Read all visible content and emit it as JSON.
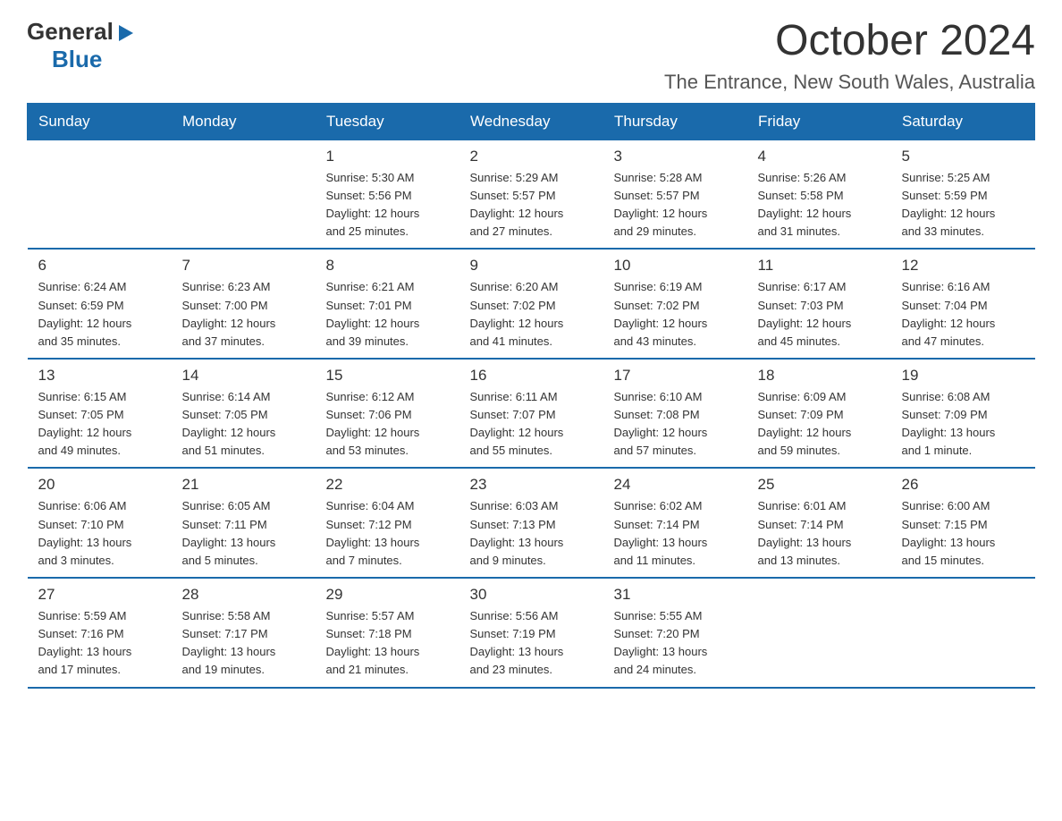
{
  "logo": {
    "general": "General",
    "arrow": "▶",
    "blue": "Blue"
  },
  "title": "October 2024",
  "subtitle": "The Entrance, New South Wales, Australia",
  "days_of_week": [
    "Sunday",
    "Monday",
    "Tuesday",
    "Wednesday",
    "Thursday",
    "Friday",
    "Saturday"
  ],
  "weeks": [
    [
      {
        "day": "",
        "info": ""
      },
      {
        "day": "",
        "info": ""
      },
      {
        "day": "1",
        "info": "Sunrise: 5:30 AM\nSunset: 5:56 PM\nDaylight: 12 hours\nand 25 minutes."
      },
      {
        "day": "2",
        "info": "Sunrise: 5:29 AM\nSunset: 5:57 PM\nDaylight: 12 hours\nand 27 minutes."
      },
      {
        "day": "3",
        "info": "Sunrise: 5:28 AM\nSunset: 5:57 PM\nDaylight: 12 hours\nand 29 minutes."
      },
      {
        "day": "4",
        "info": "Sunrise: 5:26 AM\nSunset: 5:58 PM\nDaylight: 12 hours\nand 31 minutes."
      },
      {
        "day": "5",
        "info": "Sunrise: 5:25 AM\nSunset: 5:59 PM\nDaylight: 12 hours\nand 33 minutes."
      }
    ],
    [
      {
        "day": "6",
        "info": "Sunrise: 6:24 AM\nSunset: 6:59 PM\nDaylight: 12 hours\nand 35 minutes."
      },
      {
        "day": "7",
        "info": "Sunrise: 6:23 AM\nSunset: 7:00 PM\nDaylight: 12 hours\nand 37 minutes."
      },
      {
        "day": "8",
        "info": "Sunrise: 6:21 AM\nSunset: 7:01 PM\nDaylight: 12 hours\nand 39 minutes."
      },
      {
        "day": "9",
        "info": "Sunrise: 6:20 AM\nSunset: 7:02 PM\nDaylight: 12 hours\nand 41 minutes."
      },
      {
        "day": "10",
        "info": "Sunrise: 6:19 AM\nSunset: 7:02 PM\nDaylight: 12 hours\nand 43 minutes."
      },
      {
        "day": "11",
        "info": "Sunrise: 6:17 AM\nSunset: 7:03 PM\nDaylight: 12 hours\nand 45 minutes."
      },
      {
        "day": "12",
        "info": "Sunrise: 6:16 AM\nSunset: 7:04 PM\nDaylight: 12 hours\nand 47 minutes."
      }
    ],
    [
      {
        "day": "13",
        "info": "Sunrise: 6:15 AM\nSunset: 7:05 PM\nDaylight: 12 hours\nand 49 minutes."
      },
      {
        "day": "14",
        "info": "Sunrise: 6:14 AM\nSunset: 7:05 PM\nDaylight: 12 hours\nand 51 minutes."
      },
      {
        "day": "15",
        "info": "Sunrise: 6:12 AM\nSunset: 7:06 PM\nDaylight: 12 hours\nand 53 minutes."
      },
      {
        "day": "16",
        "info": "Sunrise: 6:11 AM\nSunset: 7:07 PM\nDaylight: 12 hours\nand 55 minutes."
      },
      {
        "day": "17",
        "info": "Sunrise: 6:10 AM\nSunset: 7:08 PM\nDaylight: 12 hours\nand 57 minutes."
      },
      {
        "day": "18",
        "info": "Sunrise: 6:09 AM\nSunset: 7:09 PM\nDaylight: 12 hours\nand 59 minutes."
      },
      {
        "day": "19",
        "info": "Sunrise: 6:08 AM\nSunset: 7:09 PM\nDaylight: 13 hours\nand 1 minute."
      }
    ],
    [
      {
        "day": "20",
        "info": "Sunrise: 6:06 AM\nSunset: 7:10 PM\nDaylight: 13 hours\nand 3 minutes."
      },
      {
        "day": "21",
        "info": "Sunrise: 6:05 AM\nSunset: 7:11 PM\nDaylight: 13 hours\nand 5 minutes."
      },
      {
        "day": "22",
        "info": "Sunrise: 6:04 AM\nSunset: 7:12 PM\nDaylight: 13 hours\nand 7 minutes."
      },
      {
        "day": "23",
        "info": "Sunrise: 6:03 AM\nSunset: 7:13 PM\nDaylight: 13 hours\nand 9 minutes."
      },
      {
        "day": "24",
        "info": "Sunrise: 6:02 AM\nSunset: 7:14 PM\nDaylight: 13 hours\nand 11 minutes."
      },
      {
        "day": "25",
        "info": "Sunrise: 6:01 AM\nSunset: 7:14 PM\nDaylight: 13 hours\nand 13 minutes."
      },
      {
        "day": "26",
        "info": "Sunrise: 6:00 AM\nSunset: 7:15 PM\nDaylight: 13 hours\nand 15 minutes."
      }
    ],
    [
      {
        "day": "27",
        "info": "Sunrise: 5:59 AM\nSunset: 7:16 PM\nDaylight: 13 hours\nand 17 minutes."
      },
      {
        "day": "28",
        "info": "Sunrise: 5:58 AM\nSunset: 7:17 PM\nDaylight: 13 hours\nand 19 minutes."
      },
      {
        "day": "29",
        "info": "Sunrise: 5:57 AM\nSunset: 7:18 PM\nDaylight: 13 hours\nand 21 minutes."
      },
      {
        "day": "30",
        "info": "Sunrise: 5:56 AM\nSunset: 7:19 PM\nDaylight: 13 hours\nand 23 minutes."
      },
      {
        "day": "31",
        "info": "Sunrise: 5:55 AM\nSunset: 7:20 PM\nDaylight: 13 hours\nand 24 minutes."
      },
      {
        "day": "",
        "info": ""
      },
      {
        "day": "",
        "info": ""
      }
    ]
  ]
}
